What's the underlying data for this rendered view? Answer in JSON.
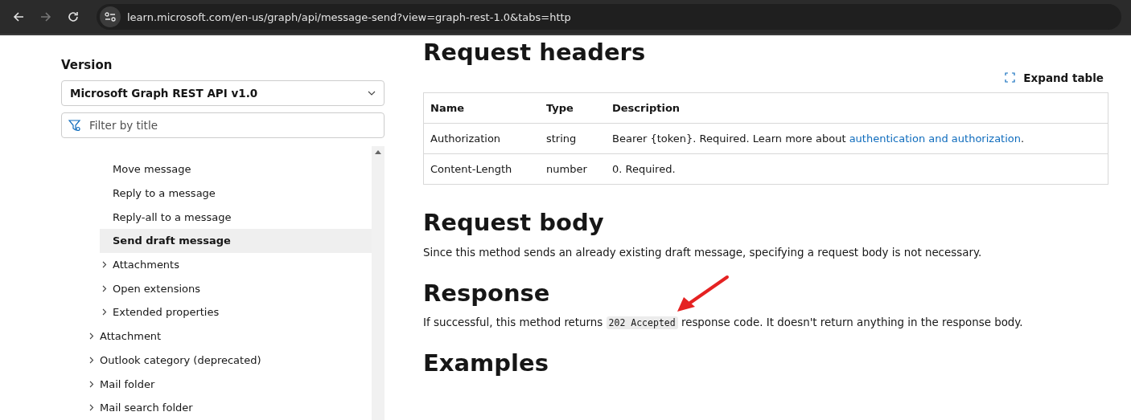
{
  "browser": {
    "url": "learn.microsoft.com/en-us/graph/api/message-send?view=graph-rest-1.0&tabs=http",
    "forward_disabled": true
  },
  "sidebar": {
    "version_label": "Version",
    "version_value": "Microsoft Graph REST API v1.0",
    "filter_placeholder": "Filter by title",
    "toc": [
      {
        "children": [
          {
            "label": "Move message",
            "selected": false,
            "expandable": false
          },
          {
            "label": "Reply to a message",
            "selected": false,
            "expandable": false
          },
          {
            "label": "Reply-all to a message",
            "selected": false,
            "expandable": false
          },
          {
            "label": "Send draft message",
            "selected": true,
            "expandable": false
          },
          {
            "label": "Attachments",
            "selected": false,
            "expandable": true
          },
          {
            "label": "Open extensions",
            "selected": false,
            "expandable": true
          },
          {
            "label": "Extended properties",
            "selected": false,
            "expandable": true
          }
        ]
      },
      {
        "label": "Attachment",
        "selected": false,
        "expandable": true
      },
      {
        "label": "Outlook category (deprecated)",
        "selected": false,
        "expandable": true
      },
      {
        "label": "Mail folder",
        "selected": false,
        "expandable": true
      },
      {
        "label": "Mail search folder",
        "selected": false,
        "expandable": true
      }
    ]
  },
  "content": {
    "headers_heading": "Request headers",
    "expand_label": "Expand table",
    "table": {
      "columns": [
        "Name",
        "Type",
        "Description"
      ],
      "rows": [
        {
          "name": "Authorization",
          "type": "string",
          "description": "Bearer {token}. Required. Learn more about ",
          "link": "authentication and authorization",
          "after": "."
        },
        {
          "name": "Content-Length",
          "type": "number",
          "description": "0. Required."
        }
      ]
    },
    "body_heading": "Request body",
    "body_text": "Since this method sends an already existing draft message, specifying a request body is not necessary.",
    "response_heading": "Response",
    "response_before": "If successful, this method returns ",
    "response_code": "202 Accepted",
    "response_after": " response code. It doesn't return anything in the response body.",
    "examples_heading": "Examples"
  }
}
